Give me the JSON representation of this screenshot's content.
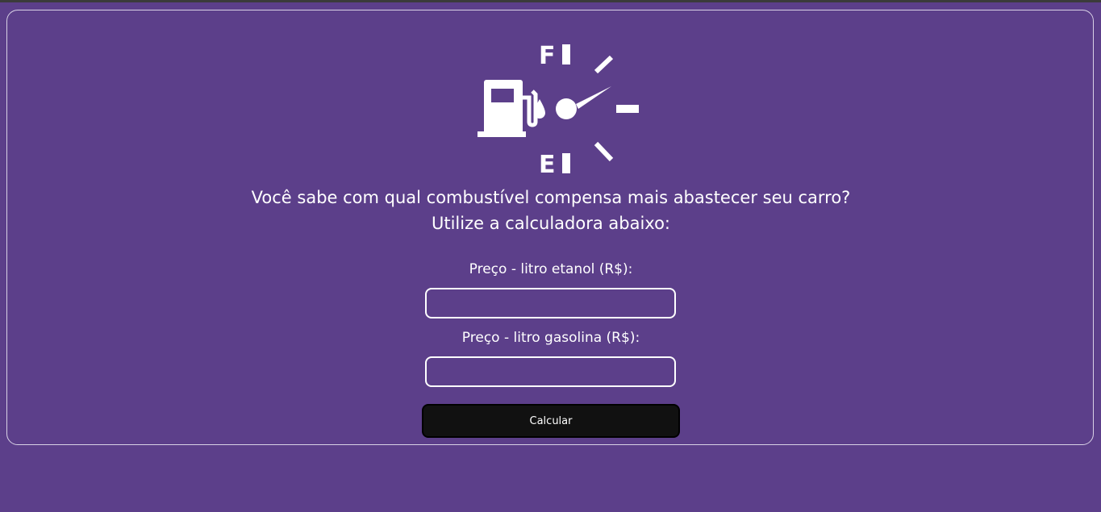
{
  "colors": {
    "background": "#5c3f8a",
    "text": "#ffffff",
    "button_bg": "#111111"
  },
  "logo": {
    "icon": "fuel-gauge-icon",
    "full_label": "F",
    "empty_label": "E"
  },
  "headline": {
    "line1": "Você sabe com qual combustível compensa mais abastecer seu carro?",
    "line2": "Utilize a calculadora abaixo:"
  },
  "form": {
    "etanol_label": "Preço - litro etanol (R$):",
    "etanol_value": "",
    "gasolina_label": "Preço - litro gasolina (R$):",
    "gasolina_value": "",
    "submit_label": "Calcular"
  }
}
